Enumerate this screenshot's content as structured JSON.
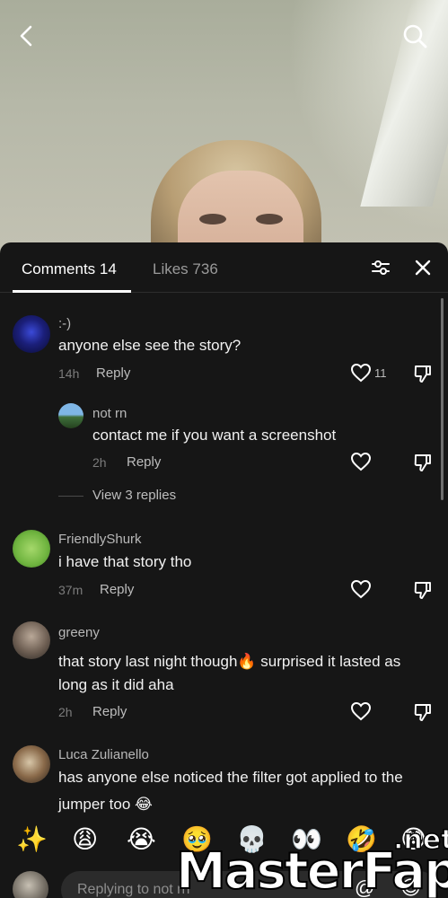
{
  "nav": {
    "back_icon": "chevron-left-icon",
    "search_icon": "search-icon"
  },
  "tabs": {
    "comments_label": "Comments 14",
    "likes_label": "Likes 736",
    "filter_icon": "sliders-icon",
    "close_icon": "close-icon"
  },
  "comments": [
    {
      "username": ":-)",
      "text": "anyone else see the story?",
      "time": "14h",
      "reply_label": "Reply",
      "like_count": "11",
      "replies": [
        {
          "username": "not rn",
          "text": "contact me if you want a screenshot",
          "time": "2h",
          "reply_label": "Reply"
        }
      ],
      "view_replies": "View 3 replies"
    },
    {
      "username": "FriendlyShurk",
      "text": "i have that story tho",
      "time": "37m",
      "reply_label": "Reply"
    },
    {
      "username": "greeny",
      "text_line1": "that story last night though🔥 surprised it lasted as",
      "text_line2": "long as it did aha",
      "time": "2h",
      "reply_label": "Reply"
    },
    {
      "username": "Luca Zulianello",
      "text_line1": "has anyone else noticed the filter got applied to the",
      "text_line2": "jumper too 😂"
    }
  ],
  "emoji_bar": [
    "✨",
    "😩",
    "😭",
    "🥹",
    "💀",
    "👀",
    "🤣",
    "😳"
  ],
  "input": {
    "placeholder": "Replying to not rn",
    "at_symbol": "@",
    "emoji_button": "😊"
  },
  "watermark": {
    "main": "MasterFap",
    "suffix": ".net"
  },
  "colors": {
    "sheet_bg": "#161616",
    "accent_text": "#ffffff",
    "secondary_text": "#b8b8b8"
  }
}
